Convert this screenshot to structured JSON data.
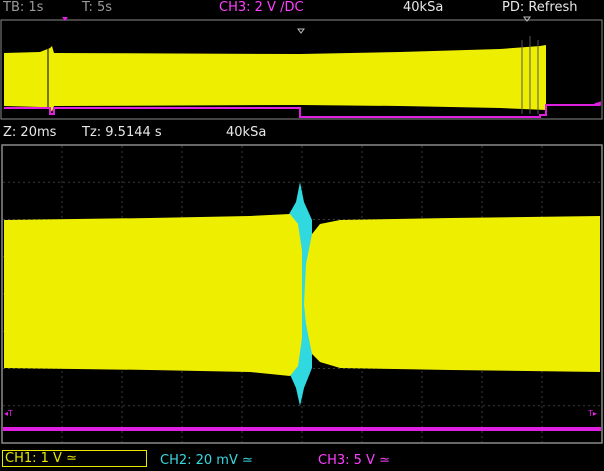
{
  "status_bar": {
    "timebase": "TB: 1s",
    "trigger_time": "T: 5s",
    "channel": "CH3: 2 V ∕DC",
    "sample_rate": "40kSa",
    "mode": "PD: Refresh"
  },
  "zoom_bar": {
    "zoom": "Z: 20ms",
    "zoom_position": "Tz: 9.5144 s",
    "sample_rate": "40kSa"
  },
  "overview": {
    "ground_marker": "◄"
  },
  "zoom_window": {
    "trigger_marker_left": "◂T",
    "trigger_marker_right": "T▸"
  },
  "channels": {
    "ch1": "CH1: 1 V ≃",
    "ch2": "CH2: 20 mV ≃",
    "ch3": "CH3: 5 V ≃"
  },
  "colors": {
    "ch1": "#eeee00",
    "ch2": "#30d8e0",
    "ch3": "#e020e0",
    "grid": "#3a3a3a",
    "border": "#8a8a8a"
  }
}
